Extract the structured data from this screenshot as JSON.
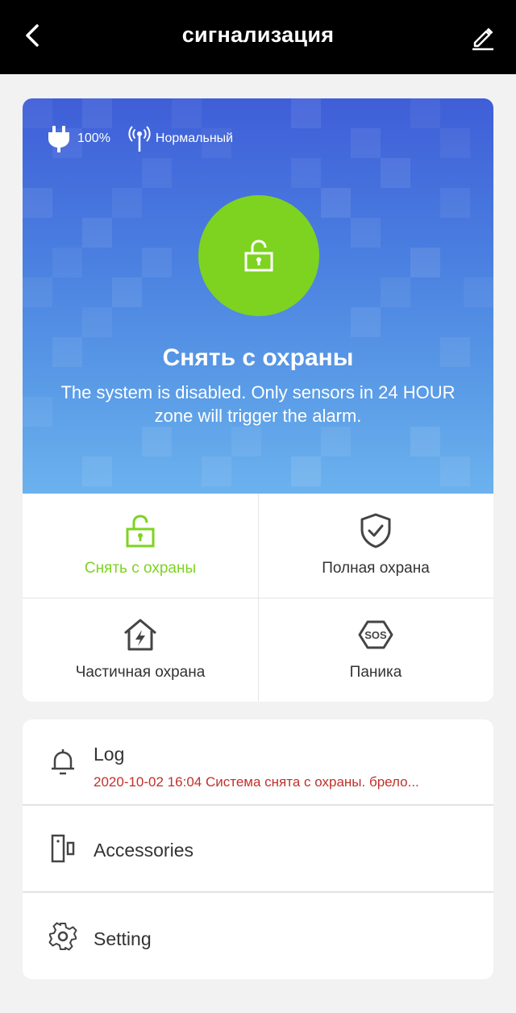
{
  "header": {
    "title": "сигнализация",
    "back_icon": "chevron-left-icon",
    "edit_icon": "pencil-icon"
  },
  "status": {
    "power": "100%",
    "signal": "Нормальный"
  },
  "hero": {
    "title": "Снять с охраны",
    "description": "The system is disabled. Only sensors in 24 HOUR zone will trigger the alarm."
  },
  "modes": [
    {
      "label": "Снять с охраны",
      "icon": "unlock-icon",
      "active": true
    },
    {
      "label": "Полная охрана",
      "icon": "shield-check-icon",
      "active": false
    },
    {
      "label": "Частичная охрана",
      "icon": "home-bolt-icon",
      "active": false
    },
    {
      "label": "Паника",
      "icon": "sos-icon",
      "active": false
    }
  ],
  "menu": {
    "log": {
      "label": "Log",
      "entry": "2020-10-02 16:04 Система снята с охраны.  брело..."
    },
    "accessories": {
      "label": "Accessories"
    },
    "setting": {
      "label": "Setting"
    }
  },
  "colors": {
    "accent": "#7ed321",
    "header_bg": "#000000",
    "log_text": "#c0312b",
    "hero_top": "#3f5ed8",
    "hero_bottom": "#6cb2ee"
  }
}
